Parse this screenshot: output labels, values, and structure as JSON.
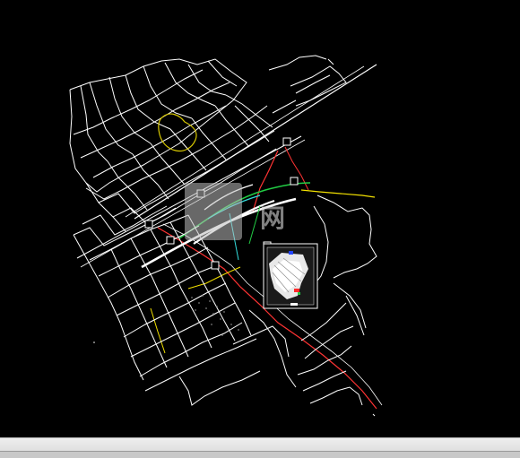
{
  "window": {
    "background": "#000000"
  },
  "colors": {
    "road": "#ffffff",
    "road_secondary": "#e8e8e8",
    "highway": "#ff3333",
    "green_line": "#22cc44",
    "cyan_line": "#33dddd",
    "yellow_line": "#f2e000",
    "pond": "#d9c900",
    "site_fill": "#ffffff",
    "site_accent_red": "#ff2a2a",
    "site_accent_blue": "#2244ff",
    "statusbar": "#e0e0e0"
  },
  "watermark": {
    "text": "网"
  },
  "statusbar": {
    "left_text": "",
    "right_text": ""
  }
}
